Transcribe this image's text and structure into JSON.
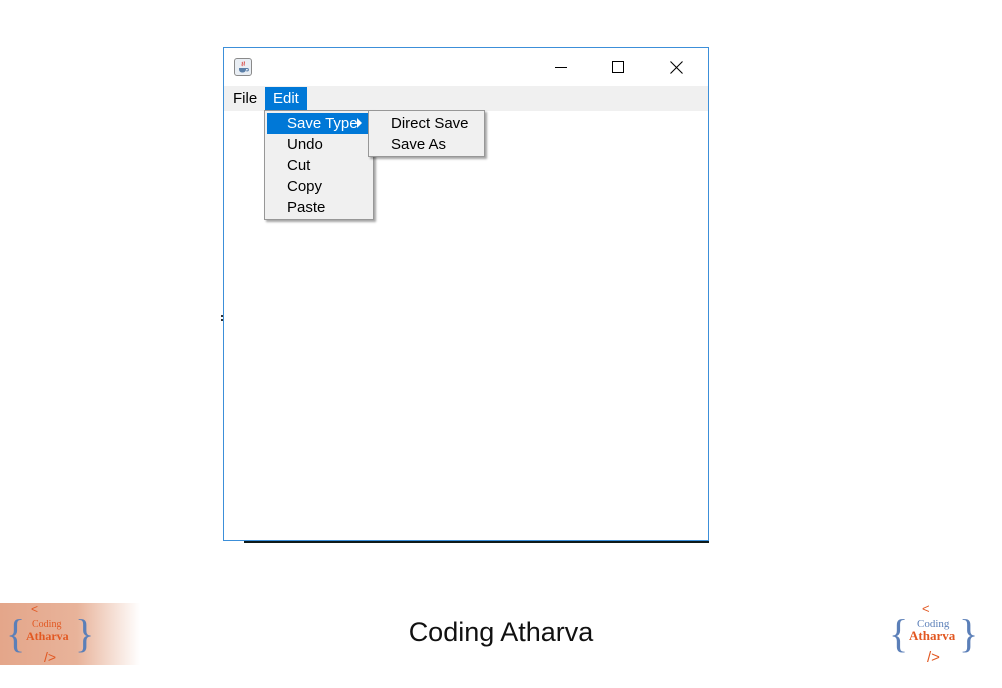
{
  "window": {
    "menubar": {
      "file_label": "File",
      "edit_label": "Edit"
    },
    "edit_menu": {
      "items": [
        "Save Type",
        "Undo",
        "Cut",
        "Copy",
        "Paste"
      ]
    },
    "save_type_submenu": {
      "items": [
        "Direct Save",
        "Save As"
      ]
    }
  },
  "footer": {
    "title": "Coding Atharva",
    "logo_text_top": "Coding",
    "logo_text_main": "Atharva",
    "logo_open_bracket": "{",
    "logo_close_bracket": "}",
    "logo_lt": "<",
    "logo_slash_gt": "/>"
  },
  "colors": {
    "accent": "#0078d7",
    "menubar_bg": "#f0f0f0",
    "window_border": "#3c8fd9",
    "logo_orange": "#e25822",
    "logo_blue": "#5b7fb8"
  },
  "icons": {
    "app": "java-cup-icon",
    "minimize": "minimize-icon",
    "maximize": "maximize-icon",
    "close": "close-icon",
    "submenu": "submenu-arrow-icon"
  }
}
